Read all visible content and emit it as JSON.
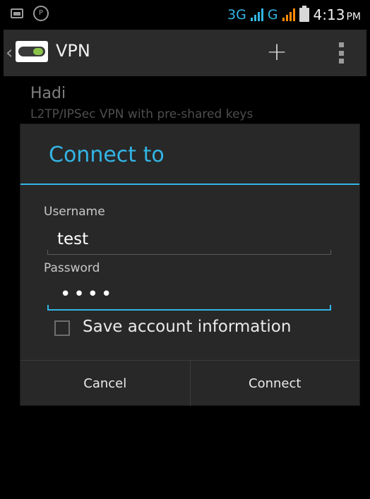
{
  "status_bar": {
    "network_1": "3G",
    "network_2": "G",
    "time": "4:13",
    "ampm": "PM",
    "icons": [
      "image-notification-icon",
      "p-circle-icon",
      "signal-bars-icon",
      "signal-bars-icon",
      "battery-icon"
    ],
    "colors": {
      "network": "#33b5e5",
      "signal_2": "#ff8a00"
    }
  },
  "action_bar": {
    "title": "VPN",
    "icons": [
      "back-caret-icon",
      "vpn-toggle-icon",
      "add-icon",
      "overflow-menu-icon"
    ]
  },
  "vpn_list": [
    {
      "name": "Hadi",
      "type": "L2TP/IPSec VPN with pre-shared keys"
    }
  ],
  "dialog": {
    "title": "Connect to",
    "username_label": "Username",
    "username_value": "test",
    "password_label": "Password",
    "password_value": "••••",
    "save_account_label": "Save account information",
    "save_account_checked": false,
    "cancel_label": "Cancel",
    "connect_label": "Connect",
    "accent_color": "#33b5e5"
  }
}
